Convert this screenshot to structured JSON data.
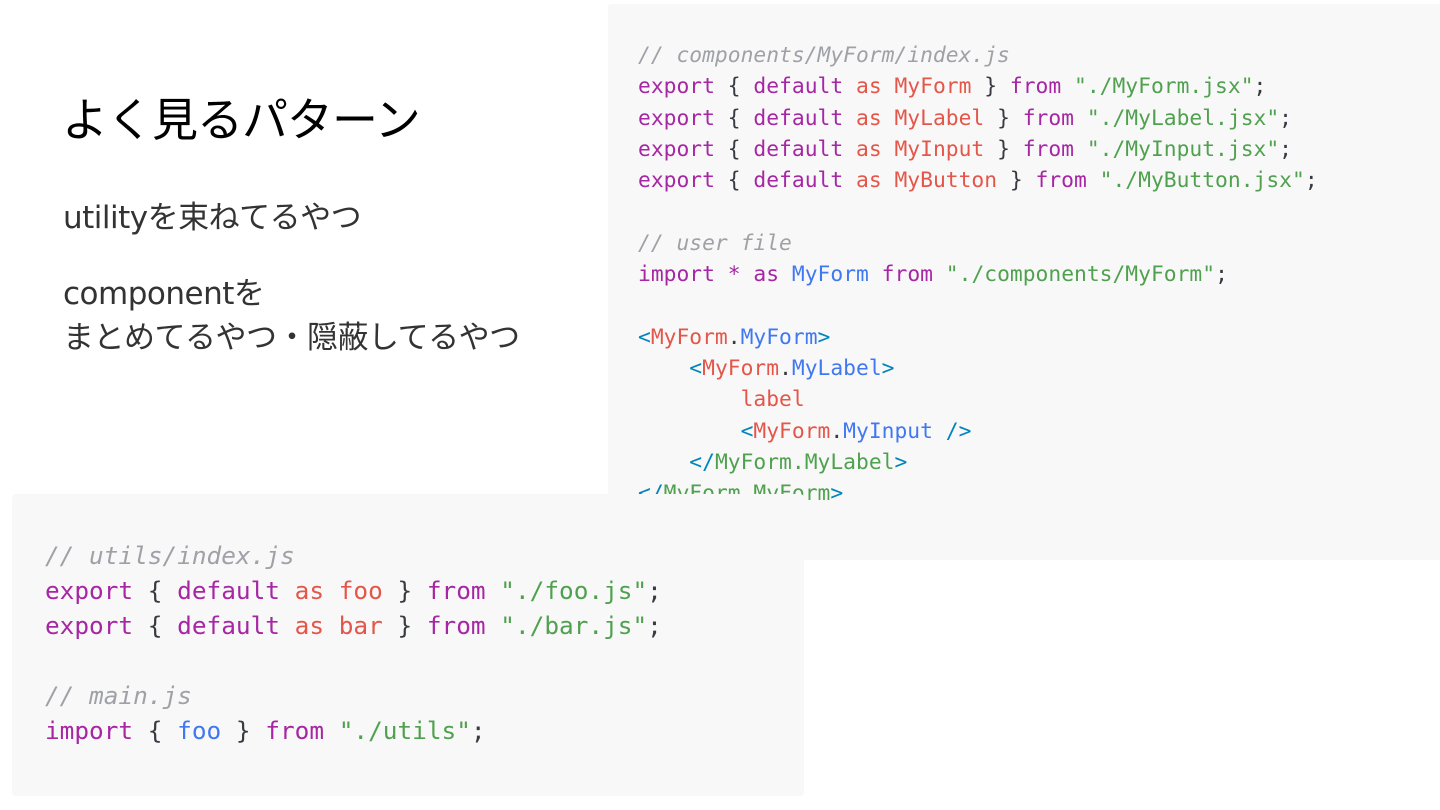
{
  "slide": {
    "title": "よく見るパターン",
    "bullet_1": "utilityを束ねてるやつ",
    "bullet_2_line_1": "componentを",
    "bullet_2_line_2": "まとめてるやつ・隠蔽してるやつ"
  },
  "code_right": {
    "lines": [
      [
        [
          "comment",
          "// components/MyForm/index.js"
        ]
      ],
      [
        [
          "keyword",
          "export"
        ],
        [
          "punct",
          " { "
        ],
        [
          "keyword",
          "default"
        ],
        [
          "punct",
          " "
        ],
        [
          "as",
          "as"
        ],
        [
          "punct",
          " "
        ],
        [
          "ident",
          "MyForm"
        ],
        [
          "punct",
          " } "
        ],
        [
          "keyword",
          "from"
        ],
        [
          "punct",
          " "
        ],
        [
          "string",
          "\"./MyForm.jsx\""
        ],
        [
          "punct",
          ";"
        ]
      ],
      [
        [
          "keyword",
          "export"
        ],
        [
          "punct",
          " { "
        ],
        [
          "keyword",
          "default"
        ],
        [
          "punct",
          " "
        ],
        [
          "as",
          "as"
        ],
        [
          "punct",
          " "
        ],
        [
          "ident",
          "MyLabel"
        ],
        [
          "punct",
          " } "
        ],
        [
          "keyword",
          "from"
        ],
        [
          "punct",
          " "
        ],
        [
          "string",
          "\"./MyLabel.jsx\""
        ],
        [
          "punct",
          ";"
        ]
      ],
      [
        [
          "keyword",
          "export"
        ],
        [
          "punct",
          " { "
        ],
        [
          "keyword",
          "default"
        ],
        [
          "punct",
          " "
        ],
        [
          "as",
          "as"
        ],
        [
          "punct",
          " "
        ],
        [
          "ident",
          "MyInput"
        ],
        [
          "punct",
          " } "
        ],
        [
          "keyword",
          "from"
        ],
        [
          "punct",
          " "
        ],
        [
          "string",
          "\"./MyInput.jsx\""
        ],
        [
          "punct",
          ";"
        ]
      ],
      [
        [
          "keyword",
          "export"
        ],
        [
          "punct",
          " { "
        ],
        [
          "keyword",
          "default"
        ],
        [
          "punct",
          " "
        ],
        [
          "as",
          "as"
        ],
        [
          "punct",
          " "
        ],
        [
          "ident",
          "MyButton"
        ],
        [
          "punct",
          " } "
        ],
        [
          "keyword",
          "from"
        ],
        [
          "punct",
          " "
        ],
        [
          "string",
          "\"./MyButton.jsx\""
        ],
        [
          "punct",
          ";"
        ]
      ],
      [],
      [
        [
          "comment",
          "// user file"
        ]
      ],
      [
        [
          "keyword",
          "import"
        ],
        [
          "punct",
          " "
        ],
        [
          "keyword",
          "*"
        ],
        [
          "punct",
          " "
        ],
        [
          "keyword",
          "as"
        ],
        [
          "punct",
          " "
        ],
        [
          "ident-blue",
          "MyForm"
        ],
        [
          "punct",
          " "
        ],
        [
          "keyword",
          "from"
        ],
        [
          "punct",
          " "
        ],
        [
          "string",
          "\"./components/MyForm\""
        ],
        [
          "punct",
          ";"
        ]
      ],
      [],
      [
        [
          "tag-bracket",
          "<"
        ],
        [
          "tag-name",
          "MyForm"
        ],
        [
          "punct",
          "."
        ],
        [
          "tag-prop",
          "MyForm"
        ],
        [
          "tag-bracket",
          ">"
        ]
      ],
      [
        [
          "punct",
          "    "
        ],
        [
          "tag-bracket",
          "<"
        ],
        [
          "tag-name",
          "MyForm"
        ],
        [
          "punct",
          "."
        ],
        [
          "tag-prop",
          "MyLabel"
        ],
        [
          "tag-bracket",
          ">"
        ]
      ],
      [
        [
          "punct",
          "        "
        ],
        [
          "text",
          "label"
        ]
      ],
      [
        [
          "punct",
          "        "
        ],
        [
          "tag-bracket",
          "<"
        ],
        [
          "tag-name",
          "MyForm"
        ],
        [
          "punct",
          "."
        ],
        [
          "tag-prop",
          "MyInput"
        ],
        [
          "tag-bracket",
          " />"
        ]
      ],
      [
        [
          "punct",
          "    "
        ],
        [
          "tag-bracket",
          "</"
        ],
        [
          "closetag",
          "MyForm.MyLabel"
        ],
        [
          "tag-bracket",
          ">"
        ]
      ],
      [
        [
          "tag-bracket",
          "</"
        ],
        [
          "closetag",
          "MyForm.MyForm"
        ],
        [
          "tag-bracket",
          ">"
        ]
      ]
    ]
  },
  "code_left": {
    "lines": [
      [
        [
          "comment",
          "// utils/index.js"
        ]
      ],
      [
        [
          "keyword",
          "export"
        ],
        [
          "punct",
          " { "
        ],
        [
          "keyword",
          "default"
        ],
        [
          "punct",
          " "
        ],
        [
          "as",
          "as"
        ],
        [
          "punct",
          " "
        ],
        [
          "ident",
          "foo"
        ],
        [
          "punct",
          " } "
        ],
        [
          "keyword",
          "from"
        ],
        [
          "punct",
          " "
        ],
        [
          "string",
          "\"./foo.js\""
        ],
        [
          "punct",
          ";"
        ]
      ],
      [
        [
          "keyword",
          "export"
        ],
        [
          "punct",
          " { "
        ],
        [
          "keyword",
          "default"
        ],
        [
          "punct",
          " "
        ],
        [
          "as",
          "as"
        ],
        [
          "punct",
          " "
        ],
        [
          "ident",
          "bar"
        ],
        [
          "punct",
          " } "
        ],
        [
          "keyword",
          "from"
        ],
        [
          "punct",
          " "
        ],
        [
          "string",
          "\"./bar.js\""
        ],
        [
          "punct",
          ";"
        ]
      ],
      [],
      [
        [
          "comment",
          "// main.js"
        ]
      ],
      [
        [
          "keyword",
          "import"
        ],
        [
          "punct",
          " { "
        ],
        [
          "ident-blue",
          "foo"
        ],
        [
          "punct",
          " } "
        ],
        [
          "keyword",
          "from"
        ],
        [
          "punct",
          " "
        ],
        [
          "string",
          "\"./utils\""
        ],
        [
          "punct",
          ";"
        ]
      ]
    ]
  }
}
